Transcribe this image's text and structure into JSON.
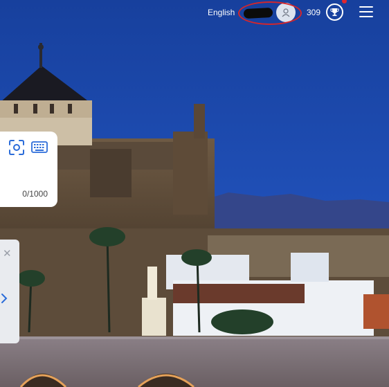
{
  "header": {
    "language_label": "English",
    "points": "309"
  },
  "icons": {
    "avatar": "user-icon",
    "trophy": "trophy-icon",
    "menu": "hamburger-menu-icon",
    "camera": "camera-scan-icon",
    "keyboard": "keyboard-icon",
    "close": "close-icon",
    "expand": "chevron-right-icon"
  },
  "input_card": {
    "char_counter": "0/1000"
  },
  "side_panel": {
    "close_glyph": "✕"
  },
  "colors": {
    "accent": "#2b6cd9",
    "annotation": "#d4262b",
    "notification": "#e0262e"
  }
}
